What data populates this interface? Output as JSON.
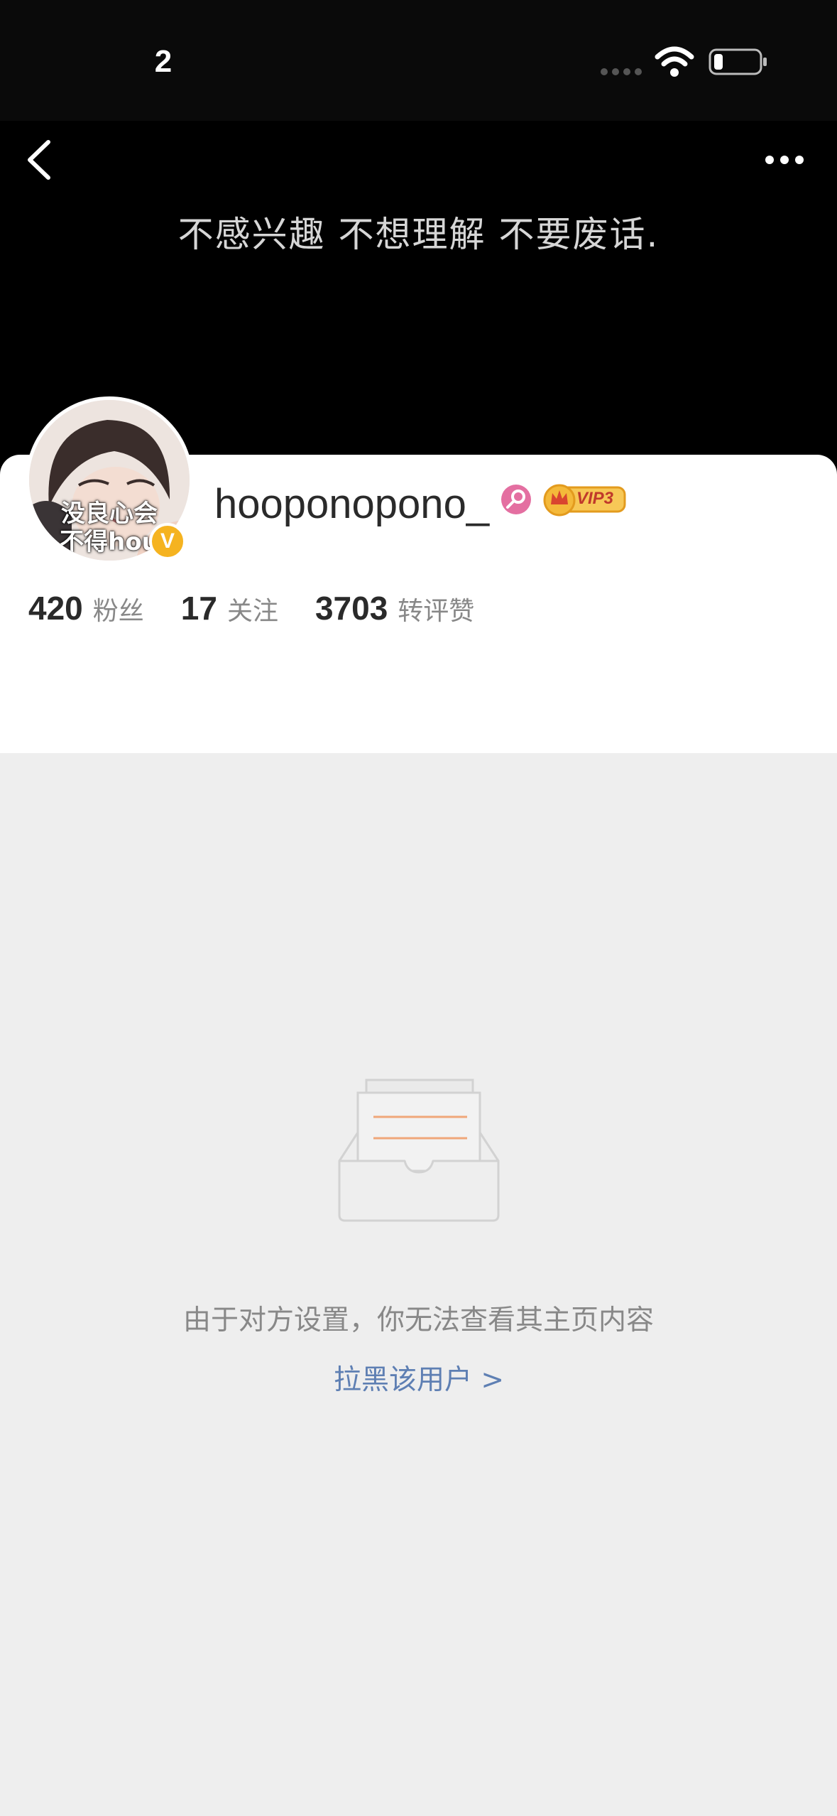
{
  "status_bar": {
    "time": "2"
  },
  "header": {
    "back_icon": "chevron-left-icon",
    "more_icon": "more-dots-icon"
  },
  "banner": {
    "motto": "不感兴趣 不想理解 不要废话."
  },
  "profile": {
    "avatar_text_line1": "没良心会",
    "avatar_text_line2": "不得hou",
    "verified_icon": "V",
    "username": "hooponopono_",
    "gender_icon": "female-icon",
    "vip_badge": "VIP3",
    "stats": {
      "followers_count": "420",
      "followers_label": "粉丝",
      "following_count": "17",
      "following_label": "关注",
      "interactions_count": "3703",
      "interactions_label": "转评赞"
    }
  },
  "empty_state": {
    "message": "由于对方设置，你无法查看其主页内容",
    "block_link": "拉黑该用户 >"
  },
  "colors": {
    "banner_bg": "#000000",
    "page_bg": "#eeeeee",
    "link": "#5e7fb3",
    "verified": "#f5b320",
    "gender": "#e46fa1",
    "vip_gold": "#f4b93a"
  }
}
